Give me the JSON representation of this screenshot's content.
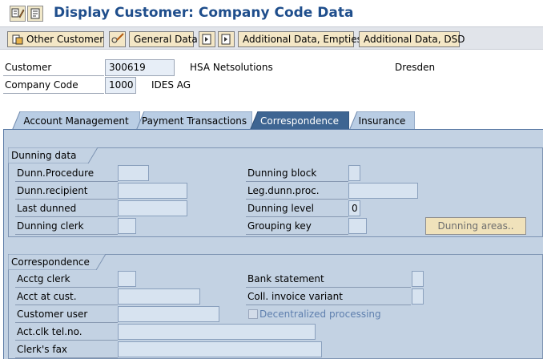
{
  "window": {
    "title": "Display Customer: Company Code Data"
  },
  "titlebar_icons": [
    "change-display-icon",
    "other-object-icon"
  ],
  "toolbar": {
    "other_customer": "Other Customer",
    "general_data": "General Data",
    "additional_empties": "Additional Data, Empties",
    "additional_dsd": "Additional Data, DSD"
  },
  "header": {
    "customer_label": "Customer",
    "customer_value": "300619",
    "customer_name": "HSA Netsolutions",
    "city": "Dresden",
    "company_code_label": "Company Code",
    "company_code_value": "1000",
    "company_code_name": "IDES AG"
  },
  "tabs": [
    {
      "label": "Account Management",
      "active": false
    },
    {
      "label": "Payment Transactions",
      "active": false
    },
    {
      "label": "Correspondence",
      "active": true
    },
    {
      "label": "Insurance",
      "active": false
    }
  ],
  "dunning": {
    "title": "Dunning data",
    "dunn_procedure": "Dunn.Procedure",
    "dunn_recipient": "Dunn.recipient",
    "last_dunned": "Last dunned",
    "dunning_clerk": "Dunning clerk",
    "dunning_block": "Dunning block",
    "leg_dunn_proc": "Leg.dunn.proc.",
    "dunning_level": "Dunning level",
    "dunning_level_value": "0",
    "grouping_key": "Grouping key",
    "dunning_areas_button": "Dunning areas.."
  },
  "correspondence": {
    "title": "Correspondence",
    "acctg_clerk": "Acctg clerk",
    "acct_at_cust": "Acct at cust.",
    "customer_user": "Customer user",
    "act_clk_tel": "Act.clk tel.no.",
    "clerks_fax": "Clerk's fax",
    "bank_statement": "Bank statement",
    "coll_invoice_variant": "Coll. invoice variant",
    "decentralized_processing": "Decentralized processing"
  },
  "colors": {
    "title": "#1f4e8c",
    "active_tab": "#3e6592",
    "inactive_tab": "#b9cde4",
    "panel": "#c3d2e3",
    "button": "#f4e7c6"
  }
}
